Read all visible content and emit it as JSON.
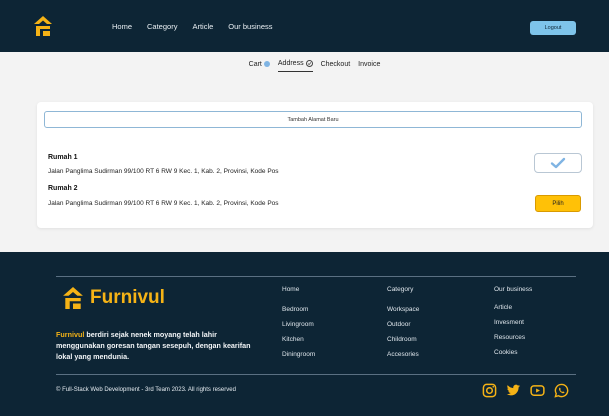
{
  "nav": {
    "links": [
      "Home",
      "Category",
      "Article",
      "Our business"
    ],
    "logout_label": "Logout"
  },
  "steps": [
    {
      "label": "Cart",
      "state": "done"
    },
    {
      "label": "Address",
      "state": "active"
    },
    {
      "label": "Checkout",
      "state": "todo"
    },
    {
      "label": "Invoice",
      "state": "todo"
    }
  ],
  "address_page": {
    "add_label": "Tambah Alamat Baru",
    "addresses": [
      {
        "name": "Rumah 1",
        "text": "Jalan Panglima Sudirman 99/100 RT 6 RW 9  Kec. 1, Kab. 2, Provinsi, Kode Pos",
        "selected": true
      },
      {
        "name": "Rumah 2",
        "text": "Jalan Panglima Sudirman 99/100 RT 6 RW 9  Kec. 1, Kab. 2, Provinsi, Kode Pos",
        "selected": false,
        "button_label": "Pilih"
      }
    ]
  },
  "footer": {
    "brand": "Furnivul",
    "tagline_highlight": "Furnivul",
    "tagline_rest": " berdiri sejak nenek moyang telah lahir menggunakan goresan tangan sesepuh, dengan kearifan lokal yang mendunia.",
    "columns": [
      {
        "head": "Home",
        "items": [
          "Bedroom",
          "Livingroom",
          "Kitchen",
          "Diningroom"
        ]
      },
      {
        "head": "Category",
        "items": [
          "Workspace",
          "Outdoor",
          "Childroom",
          "Accesories"
        ]
      },
      {
        "head": "Our business",
        "items": [
          "Article",
          "Invesment",
          "Resources",
          "Cookies"
        ]
      }
    ],
    "copyright": "© Full-Stack Web Development - 3rd Team 2023. All rights reserved",
    "socials": [
      "instagram-icon",
      "twitter-icon",
      "youtube-icon",
      "whatsapp-icon"
    ]
  },
  "colors": {
    "navy": "#0d2535",
    "accent": "#f5b316",
    "button_blue": "#7ec4ea",
    "select_yellow": "#ffc107",
    "check_blue": "#7fb4e3"
  }
}
